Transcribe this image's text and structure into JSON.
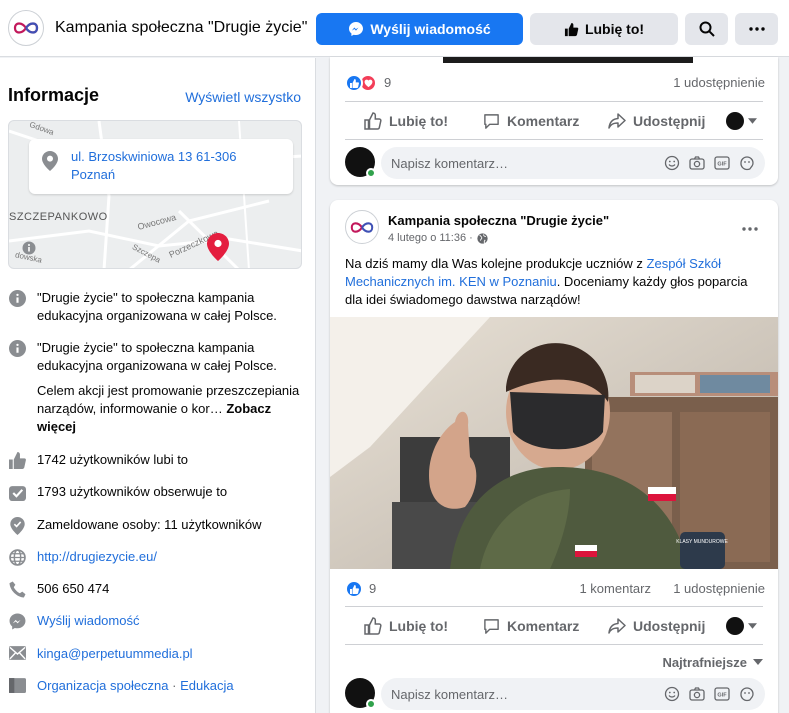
{
  "header": {
    "page_name": "Kampania społeczna \"Drugie życie\"",
    "message_button": "Wyślij wiadomość",
    "like_button": "Lubię to!"
  },
  "info": {
    "title": "Informacje",
    "view_all": "Wyświetl wszystko",
    "map": {
      "address_line1": "ul. Brzoskwiniowa 13 61-306",
      "address_line2": "Poznań",
      "district_label": "SZCZEPANKOWO",
      "street_labels": [
        "Owocowa",
        "Porzeczkowa",
        "Szczepa",
        "Gdowa",
        "dowska"
      ]
    },
    "description1": "\"Drugie życie\" to społeczna kampania edukacyjna organizowana w całej Polsce.",
    "description2": "\"Drugie życie\" to społeczna kampania edukacyjna organizowana w całej Polsce.",
    "description3": "Celem akcji jest promowanie przeszczepiania narządów, informowanie o kor…",
    "see_more": "Zobacz więcej",
    "likes": "1742 użytkowników lubi to",
    "followers": "1793 użytkowników obserwuje to",
    "checkins": "Zameldowane osoby: 11 użytkowników",
    "website": "http://drugiezycie.eu/",
    "phone": "506 650 474",
    "send_message": "Wyślij wiadomość",
    "email": "kinga@perpetuummedia.pl",
    "category1": "Organizacja społeczna",
    "category_sep": "·",
    "category2": "Edukacja"
  },
  "post1": {
    "reactions_count": "9",
    "shares": "1 udostępnienie",
    "like": "Lubię to!",
    "comment": "Komentarz",
    "share": "Udostępnij",
    "comment_placeholder": "Napisz komentarz…"
  },
  "post2": {
    "author": "Kampania społeczna \"Drugie życie\"",
    "date": "4 lutego o 11:36 ·",
    "text_before": "Na dziś mamy dla Was kolejne produkcje uczniów z ",
    "text_link": "Zespół Szkół Mechanicznych im. KEN w Poznaniu",
    "text_after": ". Doceniamy każdy głos poparcia dla idei świadomego dawstwa narządów!",
    "reactions_count": "9",
    "comments": "1 komentarz",
    "shares": "1 udostępnienie",
    "like": "Lubię to!",
    "comment": "Komentarz",
    "share": "Udostępnij",
    "sort_label": "Najtrafniejsze",
    "comment_placeholder": "Napisz komentarz…",
    "badge_text": "KLASY MUNDUROWE"
  },
  "colors": {
    "accent": "#1877f2",
    "link": "#216fdb",
    "love": "#f33e58",
    "online": "#31a24c"
  }
}
